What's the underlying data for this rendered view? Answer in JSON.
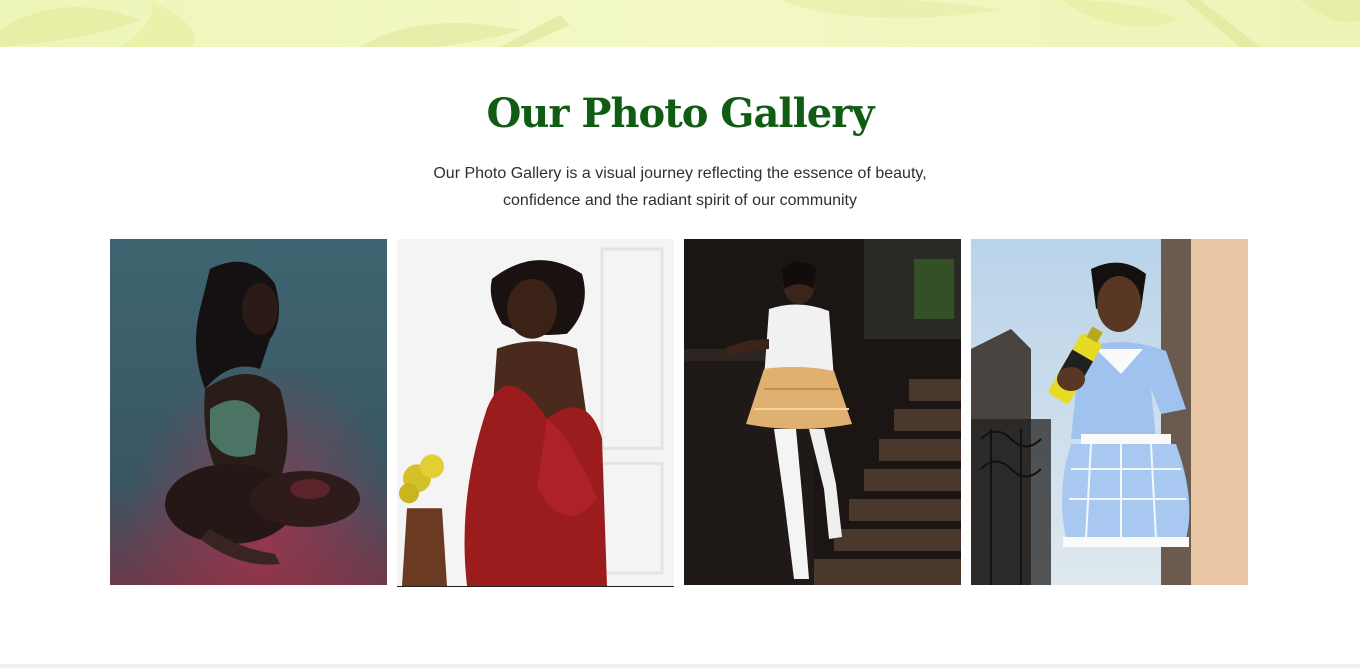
{
  "gallery": {
    "title": "Our Photo Gallery",
    "description_line1": "Our Photo Gallery is a visual journey reflecting the essence of beauty,",
    "description_line2": "confidence and the radiant spirit of our community"
  },
  "colors": {
    "title_green": "#0f5c12",
    "banner_lime": "#f0f6bf",
    "body_text": "#2f2f2f"
  },
  "photos": [
    {
      "name": "photo-1-model-teal-backdrop"
    },
    {
      "name": "photo-2-model-red-dress"
    },
    {
      "name": "photo-3-model-plaid-skirt-stairs"
    },
    {
      "name": "photo-4-model-blue-check-dress-product"
    }
  ]
}
